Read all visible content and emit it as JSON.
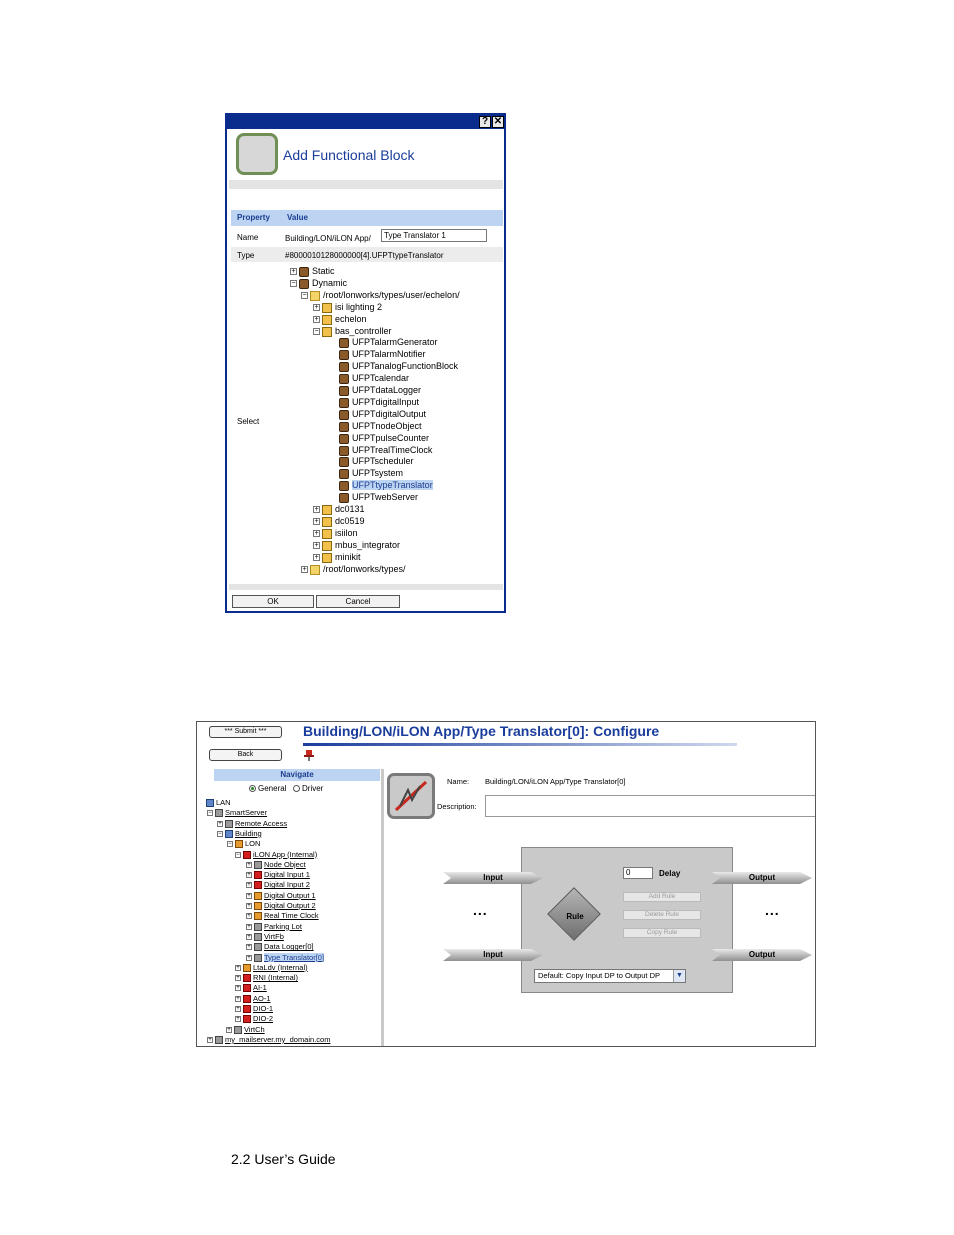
{
  "dialog": {
    "help_glyph": "?",
    "close_glyph": "✕",
    "title": "Add Functional Block",
    "columns": {
      "property": "Property",
      "value": "Value"
    },
    "name_label": "Name",
    "name_prefix": "Building/LON/iLON App/",
    "name_value": "Type Translator 1",
    "type_label": "Type",
    "type_value": "#8000010128000000[4].UFPTtypeTranslator",
    "select_label": "Select",
    "tree": [
      {
        "label": "Static",
        "pm": "+"
      },
      {
        "label": "Dynamic",
        "pm": "−"
      },
      {
        "label": "/root/lonworks/types/user/echelon/",
        "pm": "−"
      },
      {
        "label": "isi lighting 2",
        "pm": "+"
      },
      {
        "label": "echelon",
        "pm": "+"
      },
      {
        "label": "bas_controller",
        "pm": "−"
      },
      {
        "label": "UFPTalarmGenerator"
      },
      {
        "label": "UFPTalarmNotifier"
      },
      {
        "label": "UFPTanalogFunctionBlock"
      },
      {
        "label": "UFPTcalendar"
      },
      {
        "label": "UFPTdataLogger"
      },
      {
        "label": "UFPTdigitalInput"
      },
      {
        "label": "UFPTdigitalOutput"
      },
      {
        "label": "UFPTnodeObject"
      },
      {
        "label": "UFPTpulseCounter"
      },
      {
        "label": "UFPTrealTimeClock"
      },
      {
        "label": "UFPTscheduler"
      },
      {
        "label": "UFPTsystem"
      },
      {
        "label": "UFPTtypeTranslator",
        "selected": true
      },
      {
        "label": "UFPTwebServer"
      },
      {
        "label": "dc0131",
        "pm": "+"
      },
      {
        "label": "dc0519",
        "pm": "+"
      },
      {
        "label": "isiilon",
        "pm": "+"
      },
      {
        "label": "mbus_integrator",
        "pm": "+"
      },
      {
        "label": "minikit",
        "pm": "+"
      },
      {
        "label": "/root/lonworks/types/",
        "pm": "+"
      }
    ],
    "ok_label": "OK",
    "cancel_label": "Cancel"
  },
  "config": {
    "submit_label": "*** Submit ***",
    "back_label": "Back",
    "title": "Building/LON/iLON App/Type Translator[0]: Configure",
    "navigate_label": "Navigate",
    "radio_general": "General",
    "radio_driver": "Driver",
    "nav_tree": [
      {
        "label": "LAN",
        "plain": true
      },
      {
        "label": "SmartServer",
        "pm": "−"
      },
      {
        "label": "Remote Access",
        "pm": "+"
      },
      {
        "label": "Building",
        "pm": "−"
      },
      {
        "label": "LON",
        "pm": "−",
        "plain": true
      },
      {
        "label": "iLON App (Internal)",
        "pm": "−"
      },
      {
        "label": "Node Object",
        "pm": "+"
      },
      {
        "label": "Digital Input 1",
        "pm": "+"
      },
      {
        "label": "Digital Input 2",
        "pm": "+"
      },
      {
        "label": "Digital Output 1",
        "pm": "+"
      },
      {
        "label": "Digital Output 2",
        "pm": "+"
      },
      {
        "label": "Real Time Clock",
        "pm": "+"
      },
      {
        "label": "Parking Lot",
        "pm": "+"
      },
      {
        "label": "VirtFb",
        "pm": "+"
      },
      {
        "label": "Data Logger[0]",
        "pm": "+"
      },
      {
        "label": "Type Translator[0]",
        "pm": "+",
        "selected": true
      },
      {
        "label": "LtaLdv (Internal)",
        "pm": "+"
      },
      {
        "label": "RNI (Internal)",
        "pm": "+"
      },
      {
        "label": "AI-1",
        "pm": "+"
      },
      {
        "label": "AO-1",
        "pm": "+"
      },
      {
        "label": "DIO-1",
        "pm": "+"
      },
      {
        "label": "DIO-2",
        "pm": "+"
      },
      {
        "label": "VirtCh",
        "pm": "+"
      },
      {
        "label": "my_mailserver.my_domain.com",
        "pm": "+"
      }
    ],
    "name_label": "Name:",
    "name_value": "Building/LON/iLON App/Type Translator[0]",
    "description_label": "Description:",
    "input_label_1": "Input",
    "input_label_2": "Input",
    "output_label_1": "Output",
    "output_label_2": "Output",
    "ellipsis_left": "...",
    "ellipsis_right": "...",
    "delay_value": "0",
    "delay_label": "Delay",
    "add_rule": "Add Rule",
    "delete_rule": "Delete Rule",
    "copy_rule": "Copy Rule",
    "rule_label": "Rule",
    "rule_select": "Default: Copy Input DP to Output DP"
  },
  "footer": {
    "text": "2.2 User’s Guide"
  },
  "colors": {
    "title_blue": "#1a3d9c",
    "header_blue": "#bcd3f2",
    "frame_navy": "#0a2c8c"
  }
}
